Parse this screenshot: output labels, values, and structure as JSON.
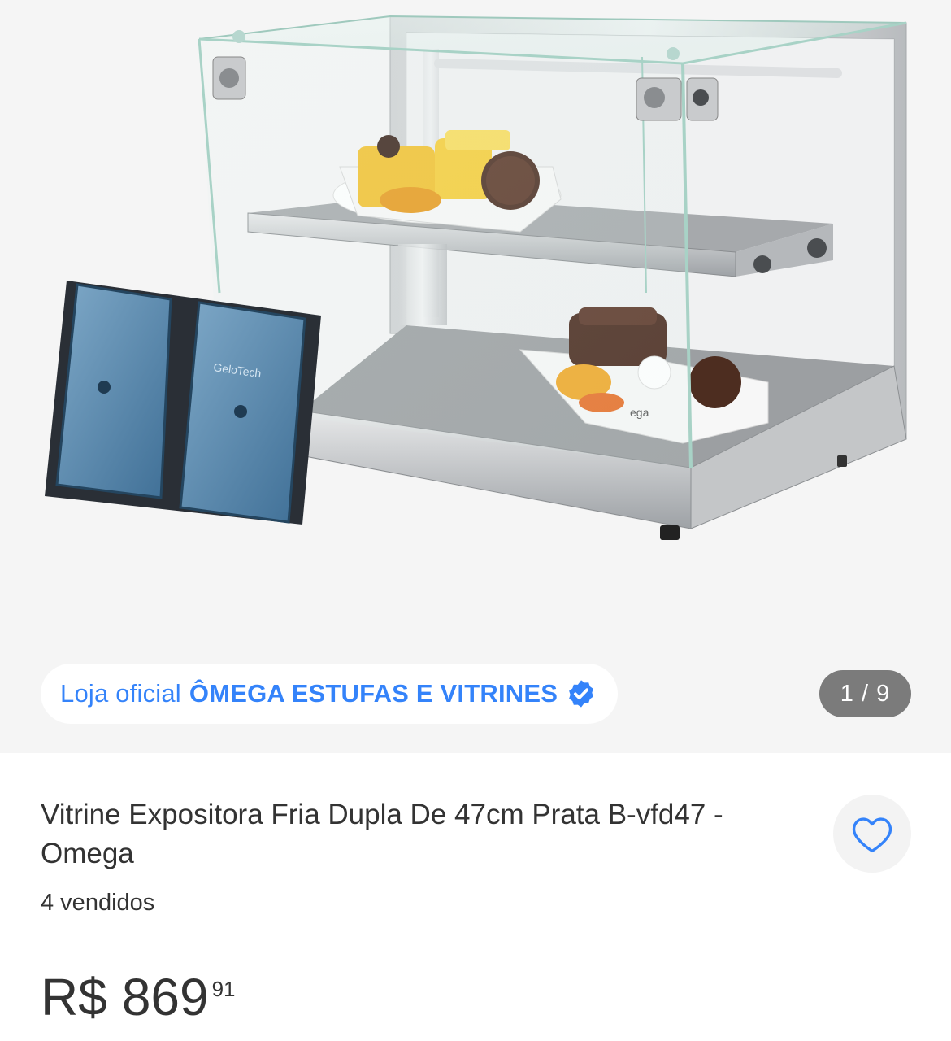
{
  "gallery": {
    "store_prefix": "Loja oficial",
    "store_name": "ÔMEGA ESTUFAS E VITRINES",
    "counter": "1 / 9",
    "image_labels": {
      "cooler_brand": "GeloTech",
      "plate_brand": "ega"
    }
  },
  "product": {
    "title": "Vitrine Expositora Fria Dupla De 47cm Prata B-vfd47 - Omega",
    "sold": "4 vendidos",
    "price_currency": "R$",
    "price_integer": "869",
    "price_cents": "91"
  },
  "colors": {
    "accent": "#3483fa",
    "text": "#333333",
    "gallery_bg": "#f5f5f5",
    "counter_bg": "#606060"
  },
  "icons": {
    "verified": "verified-badge-icon",
    "favorite": "heart-outline-icon"
  }
}
